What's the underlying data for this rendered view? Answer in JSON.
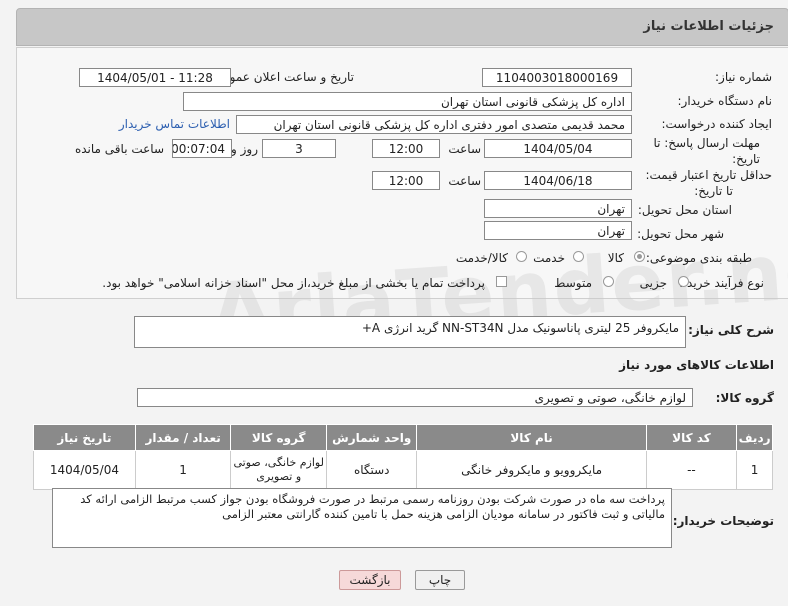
{
  "header": {
    "title": "جزئیات اطلاعات نیاز"
  },
  "form": {
    "need_number_label": "شماره نیاز:",
    "need_number": "1104003018000169",
    "announce_label": "تاریخ و ساعت اعلان عمومی:",
    "announce_value": "1404/05/01 - 11:28",
    "buyer_org_label": "نام دستگاه خریدار:",
    "buyer_org": "اداره کل پزشکی قانونی استان تهران",
    "creator_label": "ایجاد کننده درخواست:",
    "creator": "محمد قدیمی متصدی امور دفتری اداره کل پزشکی قانونی استان تهران",
    "contact_link": "اطلاعات تماس خریدار",
    "deadline_label_1": "مهلت ارسال پاسخ: تا",
    "deadline_label_2": "تاریخ:",
    "deadline_date": "1404/05/04",
    "time_label": "ساعت",
    "deadline_time": "12:00",
    "days_value": "3",
    "days_label": "روز و",
    "remaining_value": "00:07:04",
    "remaining_label": "ساعت باقی مانده",
    "price_label_1": "حداقل تاریخ اعتبار قیمت:",
    "price_label_2": "تا تاریخ:",
    "price_date": "1404/06/18",
    "price_time": "12:00",
    "province_label": "استان محل تحویل:",
    "province": "تهران",
    "city_label": "شهر محل تحویل:",
    "city": "تهران",
    "category_label": "طبقه بندی موضوعی:",
    "category_options": [
      "کالا",
      "خدمت",
      "کالا/خدمت"
    ],
    "process_label": "نوع فرآیند خرید :",
    "process_options": [
      "جزیی",
      "متوسط"
    ],
    "payment_note": "پرداخت تمام یا بخشی از مبلغ خرید،از محل \"اسناد خزانه اسلامی\" خواهد بود."
  },
  "summary": {
    "label": "شرح کلی نیاز:",
    "value": "مایکروفر 25 لیتری پاناسونیک مدل NN-ST34N گرید انرژی A+"
  },
  "goods_info_title": "اطلاعات کالاهای مورد نیاز",
  "goods_group": {
    "label": "گروه کالا:",
    "value": "لوازم خانگی، صوتی و تصویری"
  },
  "table": {
    "headers": [
      "ردیف",
      "کد کالا",
      "نام کالا",
      "واحد شمارش",
      "گروه کالا",
      "تعداد / مقدار",
      "تاریخ نیاز"
    ],
    "rows": [
      [
        "1",
        "--",
        "مایکروویو و مایکروفر خانگی",
        "دستگاه",
        "لوازم خانگی، صوتی و تصویری",
        "1",
        "1404/05/04"
      ]
    ]
  },
  "buyer_notes": {
    "label": "توضیحات خریدار:",
    "line1": "پرداخت سه ماه در صورت شرکت بودن روزنامه رسمی مرتبط در صورت فروشگاه بودن جواز کسب مرتبط الزامی ارائه کد",
    "line2": "مالیاتی و ثبت فاکتور در سامانه مودیان الزامی هزینه حمل با تامین کننده گارانتی معتبر الزامی"
  },
  "buttons": {
    "print": "چاپ",
    "back": "بازگشت"
  },
  "colors": {
    "header_bg": "#c7c7c7",
    "table_header": "#8a8a8a",
    "link": "#2d5fb0",
    "back_btn": "#f6d9d9"
  }
}
